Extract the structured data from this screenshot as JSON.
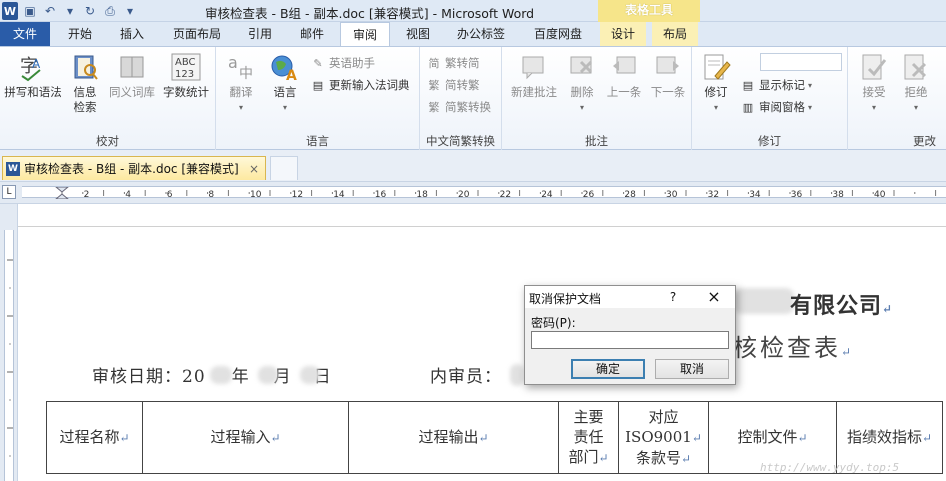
{
  "window": {
    "title": "审核检查表 - B组 - 副本.doc [兼容模式] - Microsoft Word",
    "context_header": "表格工具"
  },
  "tabs": [
    {
      "label": "文件"
    },
    {
      "label": "开始"
    },
    {
      "label": "插入"
    },
    {
      "label": "页面布局"
    },
    {
      "label": "引用"
    },
    {
      "label": "邮件"
    },
    {
      "label": "审阅"
    },
    {
      "label": "视图"
    },
    {
      "label": "办公标签"
    },
    {
      "label": "百度网盘"
    },
    {
      "label": "设计"
    },
    {
      "label": "布局"
    }
  ],
  "ribbon": {
    "proofing": {
      "label": "校对",
      "spelling": "拼写和语法",
      "research_1": "信息",
      "research_2": "检索",
      "thesaurus": "同义词库",
      "word_count": "字数统计"
    },
    "language": {
      "label": "语言",
      "translate": "翻译",
      "language": "语言",
      "english_assistant": "英语助手",
      "update_ime": "更新输入法词典"
    },
    "chinese": {
      "label": "中文简繁转换",
      "to_simplified": "繁转简",
      "to_traditional": "简转繁",
      "convert": "简繁转换"
    },
    "comments": {
      "label": "批注",
      "new": "新建批注",
      "delete": "删除",
      "previous": "上一条",
      "next": "下一条"
    },
    "tracking": {
      "label": "修订",
      "track_changes": "修订",
      "show_markup": "显示标记",
      "reviewing_pane": "审阅窗格"
    },
    "changes": {
      "label": "更改",
      "accept": "接受",
      "reject": "拒绝"
    }
  },
  "document_tab": {
    "title": "审核检查表 - B组 - 副本.doc [兼容模式]",
    "close": "×"
  },
  "ruler": {
    "marks": [
      "2",
      "4",
      "6",
      "8",
      "10",
      "12",
      "14",
      "16",
      "18",
      "20",
      "22",
      "24",
      "26",
      "28",
      "30",
      "32",
      "34",
      "36",
      "38",
      "40"
    ]
  },
  "document": {
    "company_suffix": "有限公司",
    "title_suffix": "核检查表",
    "audit_date_label": "审核日期：",
    "year_prefix": "20",
    "year": "年",
    "month": "月",
    "day": "日",
    "auditor_label": "内审员：",
    "table_headers": {
      "process_name": "过程名称",
      "process_input": "过程输入",
      "process_output": "过程输出",
      "dept_1": "主要",
      "dept_2": "责任",
      "dept_3": "部门",
      "iso_1": "对应",
      "iso_2": "ISO9001",
      "iso_3": "条款号",
      "control_doc": "控制文件",
      "kpi": "指绩效指标"
    },
    "watermark": "http://www.yydy.top:5"
  },
  "dialog": {
    "title": "取消保护文档",
    "help": "?",
    "close": "×",
    "password_label": "密码(P):",
    "password_value": "",
    "ok": "确定",
    "cancel": "取消"
  }
}
